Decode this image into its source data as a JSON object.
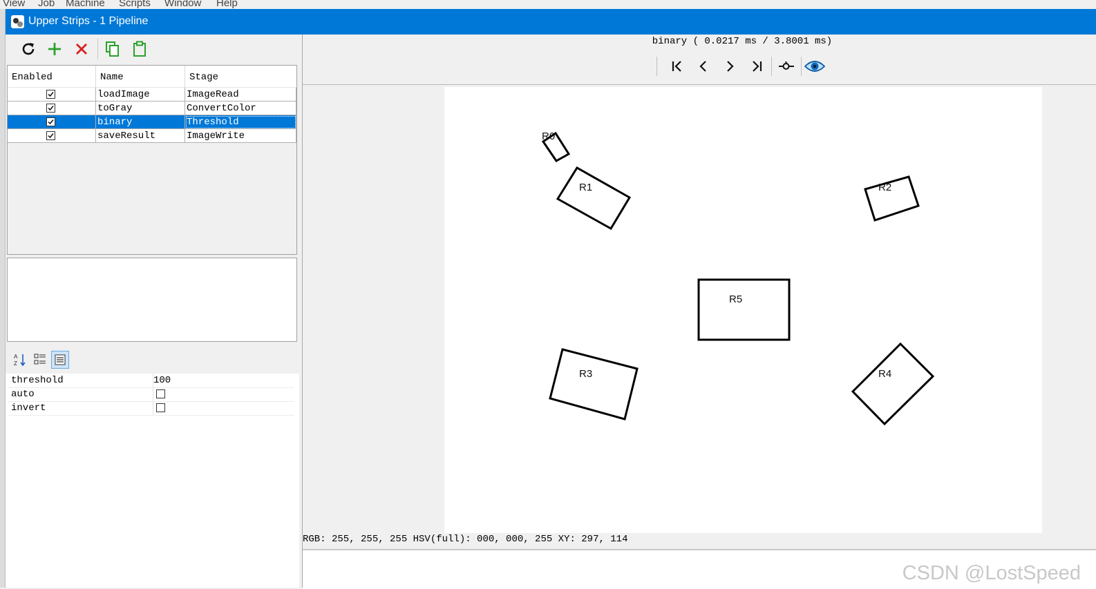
{
  "background_menu": [
    "View",
    "Job",
    "Machine",
    "Scripts",
    "Window",
    "Help"
  ],
  "window": {
    "title": "Upper Strips - 1 Pipeline"
  },
  "toolbar": {
    "refresh_icon": "refresh-icon",
    "add_icon": "plus-icon",
    "delete_icon": "close-icon",
    "copy_icon": "copy-icon",
    "paste_icon": "paste-icon",
    "colors": {
      "add": "#2aa12a",
      "delete": "#d6201f",
      "copy_paste": "#2aa12a"
    }
  },
  "stages_table": {
    "headers": [
      "Enabled",
      "Name",
      "Stage"
    ],
    "rows": [
      {
        "enabled": true,
        "name": "loadImage",
        "stage": "ImageRead"
      },
      {
        "enabled": true,
        "name": "toGray",
        "stage": "ConvertColor"
      },
      {
        "enabled": true,
        "name": "binary",
        "stage": "Threshold",
        "selected": true
      },
      {
        "enabled": true,
        "name": "saveResult",
        "stage": "ImageWrite"
      }
    ]
  },
  "properties": {
    "toolbar_icons": [
      "sort-alpha-icon",
      "categorized-icon",
      "property-pages-icon"
    ],
    "rows": [
      {
        "name": "threshold",
        "value": "100"
      },
      {
        "name": "auto",
        "checked": false
      },
      {
        "name": "invert",
        "checked": false
      }
    ]
  },
  "viewer": {
    "stage_info": "binary ( 0.0217 ms / 3.8001 ms)",
    "nav_icons": [
      "first-icon",
      "prev-icon",
      "next-icon",
      "last-icon",
      "probe-icon",
      "eye-icon"
    ],
    "status": "RGB: 255, 255, 255 HSV(full): 000, 000, 255 XY: 297, 114",
    "shape_labels": [
      "R0",
      "R1",
      "R2",
      "R3",
      "R4",
      "R5"
    ]
  },
  "watermark": "CSDN @LostSpeed"
}
